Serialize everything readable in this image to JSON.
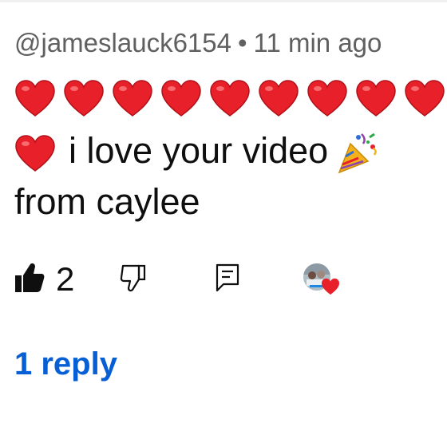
{
  "comment": {
    "author": "@jameslauck6154",
    "separator": "•",
    "time": "11 min ago",
    "text": "i love your video",
    "text_line2": "from caylee",
    "heart_emoji_count_row1": 9
  },
  "actions": {
    "like_count": "2"
  },
  "replies": {
    "label": "1 reply"
  },
  "colors": {
    "meta": "#606060",
    "text": "#0f0f0f",
    "link": "#065fd4",
    "heart": "#e8202a"
  },
  "icons": [
    "thumbs-up-icon",
    "thumbs-down-icon",
    "reply-comment-icon",
    "creator-heart-icon",
    "heart-emoji-icon",
    "party-popper-icon"
  ]
}
